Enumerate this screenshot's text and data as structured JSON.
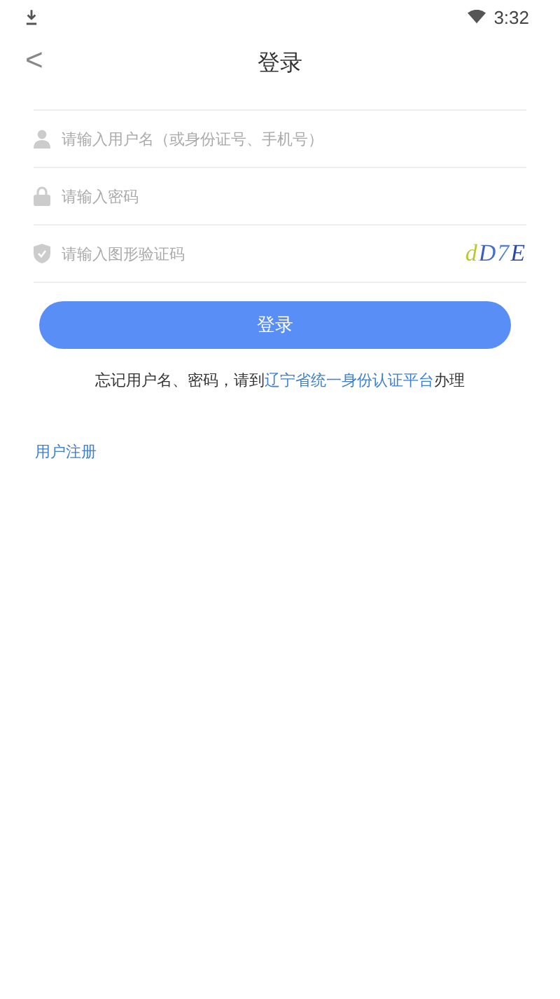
{
  "status_bar": {
    "time": "3:32"
  },
  "header": {
    "back": "<",
    "title": "登录"
  },
  "fields": [
    {
      "kind": "user",
      "placeholder": "请输入用户名（或身份证号、手机号）"
    },
    {
      "kind": "lock",
      "placeholder": "请输入密码"
    },
    {
      "kind": "shield",
      "placeholder": "请输入图形验证码",
      "captcha": "dD7E"
    }
  ],
  "login_button": "登录",
  "help": {
    "before": "忘记用户名、密码，请到",
    "link": "辽宁省统一身份认证平台",
    "after": "办理"
  },
  "register_link": "用户注册"
}
